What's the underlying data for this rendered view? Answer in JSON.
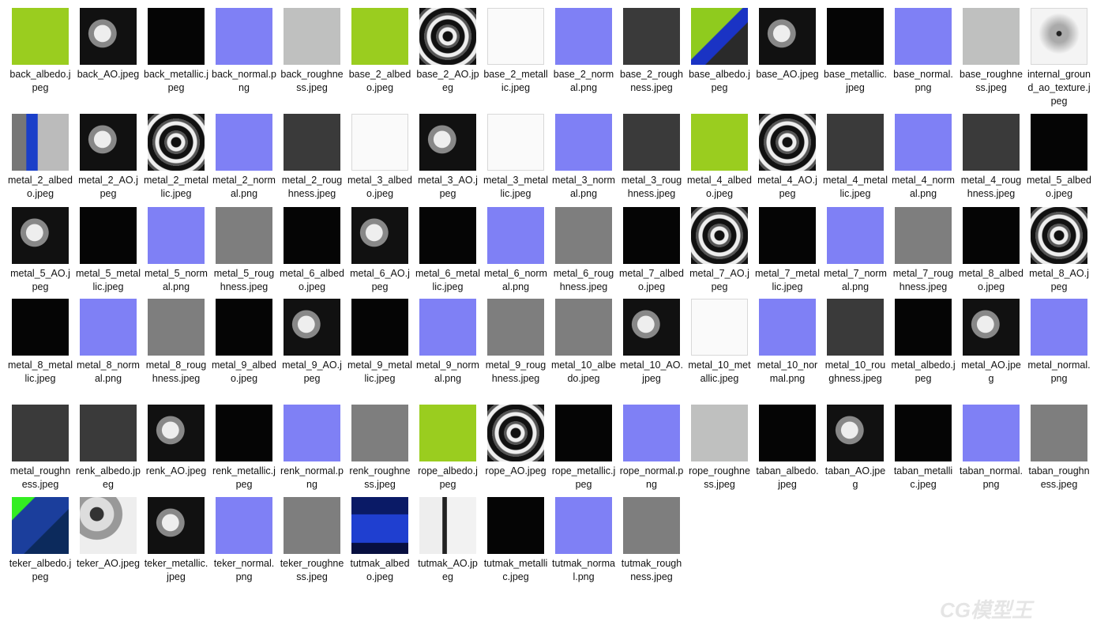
{
  "watermark": "CG模型王",
  "files": [
    {
      "name": "back_albedo.jpeg",
      "kind": "albedo-green"
    },
    {
      "name": "back_AO.jpeg",
      "kind": "ao-dark"
    },
    {
      "name": "back_metallic.jpeg",
      "kind": "black"
    },
    {
      "name": "back_normal.png",
      "kind": "normal"
    },
    {
      "name": "back_roughness.jpeg",
      "kind": "light-gray"
    },
    {
      "name": "base_2_albedo.jpeg",
      "kind": "albedo-green"
    },
    {
      "name": "base_2_AO.jpeg",
      "kind": "ao-rings"
    },
    {
      "name": "base_2_metallic.jpeg",
      "kind": "white"
    },
    {
      "name": "base_2_normal.png",
      "kind": "normal"
    },
    {
      "name": "base_2_roughness.jpeg",
      "kind": "dark-gray"
    },
    {
      "name": "base_albedo.jpeg",
      "kind": "albedo-mix"
    },
    {
      "name": "base_AO.jpeg",
      "kind": "ao-dark"
    },
    {
      "name": "base_metallic.jpeg",
      "kind": "black"
    },
    {
      "name": "base_normal.png",
      "kind": "normal"
    },
    {
      "name": "base_roughness.jpeg",
      "kind": "light-gray"
    },
    {
      "name": "internal_ground_ao_texture.jpeg",
      "kind": "ao-ground"
    },
    {
      "name": "metal_2_albedo.jpeg",
      "kind": "metal-blue"
    },
    {
      "name": "metal_2_AO.jpeg",
      "kind": "ao-dark"
    },
    {
      "name": "metal_2_metallic.jpeg",
      "kind": "ao-rings"
    },
    {
      "name": "metal_2_normal.png",
      "kind": "normal"
    },
    {
      "name": "metal_2_roughness.jpeg",
      "kind": "dark-gray"
    },
    {
      "name": "metal_3_albedo.jpeg",
      "kind": "white"
    },
    {
      "name": "metal_3_AO.jpeg",
      "kind": "ao-dark"
    },
    {
      "name": "metal_3_metallic.jpeg",
      "kind": "white"
    },
    {
      "name": "metal_3_normal.png",
      "kind": "normal"
    },
    {
      "name": "metal_3_roughness.jpeg",
      "kind": "dark-gray"
    },
    {
      "name": "metal_4_albedo.jpeg",
      "kind": "albedo-green"
    },
    {
      "name": "metal_4_AO.jpeg",
      "kind": "ao-rings"
    },
    {
      "name": "metal_4_metallic.jpeg",
      "kind": "dark-gray"
    },
    {
      "name": "metal_4_normal.png",
      "kind": "normal"
    },
    {
      "name": "metal_4_roughness.jpeg",
      "kind": "dark-gray"
    },
    {
      "name": "metal_5_albedo.jpeg",
      "kind": "black"
    },
    {
      "name": "metal_5_AO.jpeg",
      "kind": "ao-dark"
    },
    {
      "name": "metal_5_metallic.jpeg",
      "kind": "black"
    },
    {
      "name": "metal_5_normal.png",
      "kind": "normal"
    },
    {
      "name": "metal_5_roughness.jpeg",
      "kind": "mid-gray"
    },
    {
      "name": "metal_6_albedo.jpeg",
      "kind": "black"
    },
    {
      "name": "metal_6_AO.jpeg",
      "kind": "ao-dark"
    },
    {
      "name": "metal_6_metallic.jpeg",
      "kind": "black"
    },
    {
      "name": "metal_6_normal.png",
      "kind": "normal"
    },
    {
      "name": "metal_6_roughness.jpeg",
      "kind": "mid-gray"
    },
    {
      "name": "metal_7_albedo.jpeg",
      "kind": "black"
    },
    {
      "name": "metal_7_AO.jpeg",
      "kind": "ao-rings"
    },
    {
      "name": "metal_7_metallic.jpeg",
      "kind": "black"
    },
    {
      "name": "metal_7_normal.png",
      "kind": "normal"
    },
    {
      "name": "metal_7_roughness.jpeg",
      "kind": "mid-gray"
    },
    {
      "name": "metal_8_albedo.jpeg",
      "kind": "black"
    },
    {
      "name": "metal_8_AO.jpeg",
      "kind": "ao-rings"
    },
    {
      "name": "metal_8_metallic.jpeg",
      "kind": "black"
    },
    {
      "name": "metal_8_normal.png",
      "kind": "normal"
    },
    {
      "name": "metal_8_roughness.jpeg",
      "kind": "mid-gray"
    },
    {
      "name": "metal_9_albedo.jpeg",
      "kind": "black"
    },
    {
      "name": "metal_9_AO.jpeg",
      "kind": "ao-dark"
    },
    {
      "name": "metal_9_metallic.jpeg",
      "kind": "black"
    },
    {
      "name": "metal_9_normal.png",
      "kind": "normal"
    },
    {
      "name": "metal_9_roughness.jpeg",
      "kind": "mid-gray"
    },
    {
      "name": "metal_10_albedo.jpeg",
      "kind": "mid-gray"
    },
    {
      "name": "metal_10_AO.jpeg",
      "kind": "ao-dark"
    },
    {
      "name": "metal_10_metallic.jpeg",
      "kind": "white"
    },
    {
      "name": "metal_10_normal.png",
      "kind": "normal"
    },
    {
      "name": "metal_10_roughness.jpeg",
      "kind": "dark-gray"
    },
    {
      "name": "metal_albedo.jpeg",
      "kind": "black"
    },
    {
      "name": "metal_AO.jpeg",
      "kind": "ao-dark"
    },
    {
      "name": "metal_normal.png",
      "kind": "normal"
    },
    {
      "name": "metal_roughness.jpeg",
      "kind": "dark-gray"
    },
    {
      "name": "renk_albedo.jpeg",
      "kind": "dark-gray"
    },
    {
      "name": "renk_AO.jpeg",
      "kind": "ao-dark"
    },
    {
      "name": "renk_metallic.jpeg",
      "kind": "black"
    },
    {
      "name": "renk_normal.png",
      "kind": "normal"
    },
    {
      "name": "renk_roughness.jpeg",
      "kind": "mid-gray"
    },
    {
      "name": "rope_albedo.jpeg",
      "kind": "albedo-green"
    },
    {
      "name": "rope_AO.jpeg",
      "kind": "ao-rings"
    },
    {
      "name": "rope_metallic.jpeg",
      "kind": "black"
    },
    {
      "name": "rope_normal.png",
      "kind": "normal"
    },
    {
      "name": "rope_roughness.jpeg",
      "kind": "light-gray"
    },
    {
      "name": "taban_albedo.jpeg",
      "kind": "black"
    },
    {
      "name": "taban_AO.jpeg",
      "kind": "ao-dark"
    },
    {
      "name": "taban_metallic.jpeg",
      "kind": "black"
    },
    {
      "name": "taban_normal.png",
      "kind": "normal"
    },
    {
      "name": "taban_roughness.jpeg",
      "kind": "mid-gray"
    },
    {
      "name": "teker_albedo.jpeg",
      "kind": "teker-albedo"
    },
    {
      "name": "teker_AO.jpeg",
      "kind": "ao-light"
    },
    {
      "name": "teker_metallic.jpeg",
      "kind": "ao-dark"
    },
    {
      "name": "teker_normal.png",
      "kind": "normal"
    },
    {
      "name": "teker_roughness.jpeg",
      "kind": "mid-gray"
    },
    {
      "name": "tutmak_albedo.jpeg",
      "kind": "tutmak-albedo"
    },
    {
      "name": "tutmak_AO.jpeg",
      "kind": "tutmak-ao"
    },
    {
      "name": "tutmak_metallic.jpeg",
      "kind": "black"
    },
    {
      "name": "tutmak_normal.png",
      "kind": "normal"
    },
    {
      "name": "tutmak_roughness.jpeg",
      "kind": "mid-gray"
    }
  ]
}
